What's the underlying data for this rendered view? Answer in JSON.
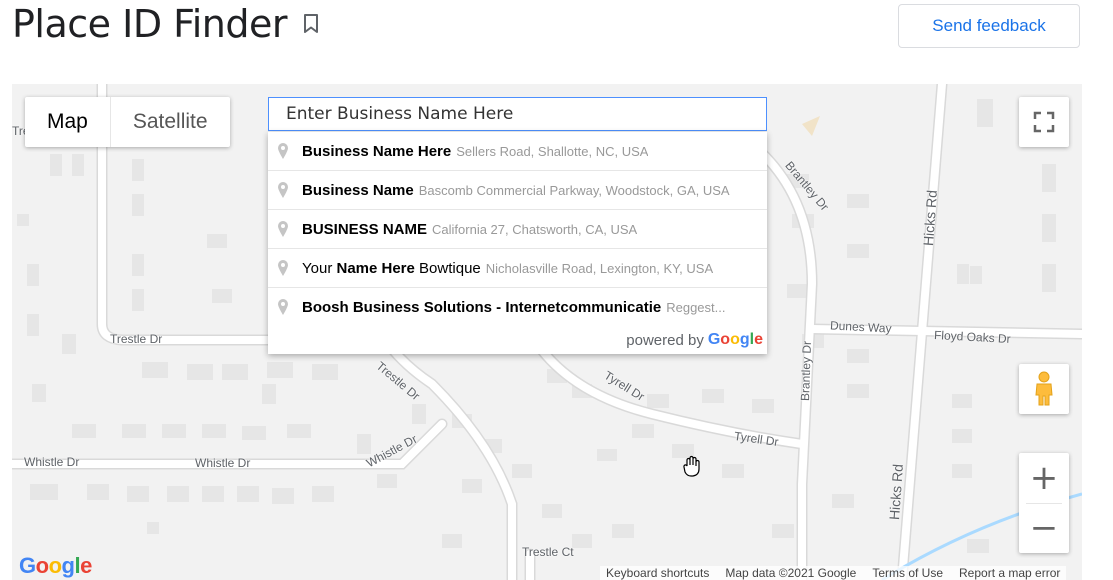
{
  "header": {
    "title": "Place ID Finder",
    "feedback_label": "Send feedback"
  },
  "map": {
    "maptype": {
      "map_label": "Map",
      "satellite_label": "Satellite",
      "selected": "Map"
    },
    "search": {
      "value": "Enter Business Name Here"
    },
    "suggestions": [
      {
        "pre": "",
        "bold": "Business Name Here",
        "post": "",
        "secondary": "Sellers Road, Shallotte, NC, USA"
      },
      {
        "pre": "",
        "bold": "Business Name",
        "post": "",
        "secondary": "Bascomb Commercial Parkway, Woodstock, GA, USA"
      },
      {
        "pre": "",
        "bold": "BUSINESS NAME",
        "post": "",
        "secondary": "California 27, Chatsworth, CA, USA"
      },
      {
        "pre": "Your ",
        "bold": "Name Here",
        "post": " Bowtique",
        "secondary": "Nicholasville Road, Lexington, KY, USA"
      },
      {
        "pre": "",
        "bold": "Boosh Business Solutions - Internetcommunicatie",
        "post": "",
        "secondary": "Reggest..."
      }
    ],
    "powered_by": "powered by",
    "powered_brand": "Google",
    "streets": {
      "trestle_dr_1": "Trestle Dr",
      "trestle_dr_2": "Trestle Dr",
      "whistle_dr_1": "Whistle Dr",
      "whistle_dr_2": "Whistle Dr",
      "whistle_dr_3": "Whistle Dr",
      "tyrell_dr_1": "Tyrell Dr",
      "tyrell_dr_2": "Tyrell Dr",
      "brantley_dr_1": "Brantley Dr",
      "brantley_dr_2": "Brantley Dr",
      "hicks_rd_1": "Hicks Rd",
      "hicks_rd_2": "Hicks Rd",
      "dunes_way": "Dunes Way",
      "floyd_oaks_dr": "Floyd Oaks Dr",
      "trestle_ct": "Trestle Ct",
      "clipped_tre": "Tre"
    },
    "controls": {
      "zoom_in": "+",
      "zoom_out": "−"
    },
    "google_logo": "Google",
    "attribution": {
      "keyboard": "Keyboard shortcuts",
      "map_data": "Map data ©2021 Google",
      "terms": "Terms of Use",
      "report": "Report a map error"
    },
    "colors": {
      "map_bg": "#f2f2f2",
      "road": "#ffffff",
      "road_border": "#d6d6d6",
      "building": "#e4e4e4",
      "water": "#aadaff",
      "accent_blue": "#1a73e8"
    }
  }
}
